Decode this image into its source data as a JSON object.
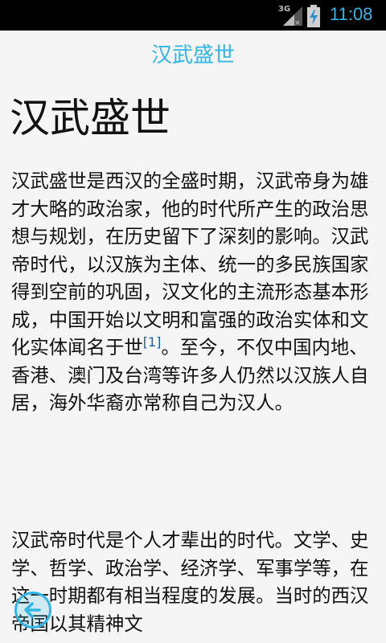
{
  "status_bar": {
    "network": "3G",
    "time": "11:08",
    "accent_color": "#33b5e5"
  },
  "header": {
    "title": "汉武盛世"
  },
  "article": {
    "title": "汉武盛世",
    "paragraphs": [
      {
        "before": "汉武盛世是西汉的全盛时期，汉武帝身为雄才大略的政治家，他的时代所产生的政治思想与规划，在历史留下了深刻的影响。汉武帝时代，以汉族为主体、统一的多民族国家得到空前的巩固，汉文化的主流形态基本形成，中国开始以文明和富强的政治实体和文化实体闻名于世",
        "citation": "[1]",
        "after": "。至今，不仅中国内地、香港、澳门及台湾等许多人仍然以汉族人自居，海外华裔亦常称自己为汉人。"
      },
      {
        "text": "汉武帝时代是个人才辈出的时代。文学、史学、哲学、政治学、经济学、军事学等，在这一时期都有相当程度的发展。当时的西汉帝国以其精神文"
      }
    ]
  },
  "icons": {
    "back": "back-arrow-icon",
    "signal": "signal-icon",
    "battery": "battery-charging-icon"
  }
}
